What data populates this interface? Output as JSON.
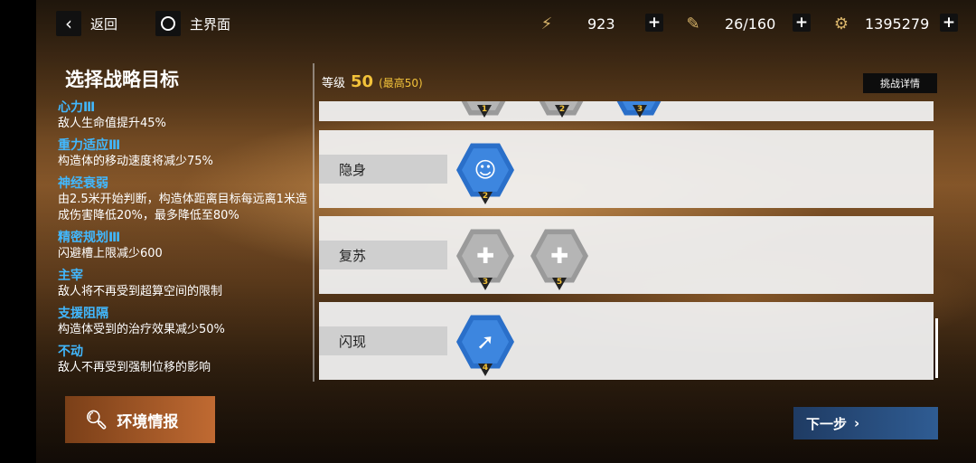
{
  "topbar": {
    "back_label": "返回",
    "home_label": "主界面",
    "resources": [
      {
        "icon": "battery-icon",
        "value": "923"
      },
      {
        "icon": "syringe-icon",
        "value": "26/160"
      },
      {
        "icon": "coin-icon",
        "value": "1395279"
      }
    ],
    "plus_symbol": "+"
  },
  "left_panel": {
    "title": "选择战略目标",
    "goals": [
      {
        "name": "心力Ⅲ",
        "desc": "敌人生命值提升45%"
      },
      {
        "name": "重力适应Ⅲ",
        "desc": "构造体的移动速度将减少75%"
      },
      {
        "name": "神经衰弱",
        "desc": "由2.5米开始判断，构造体距离目标每远离1米造成伤害降低20%，最多降低至80%"
      },
      {
        "name": "精密规划Ⅲ",
        "desc": "闪避槽上限减少600"
      },
      {
        "name": "主宰",
        "desc": "敌人将不再受到超算空间的限制"
      },
      {
        "name": "支援阻隔",
        "desc": "构造体受到的治疗效果减少50%"
      },
      {
        "name": "不动",
        "desc": "敌人不再受到强制位移的影响"
      }
    ]
  },
  "level": {
    "label": "等级",
    "value": "50",
    "max": "(最高50)"
  },
  "detail_button": "挑战详情",
  "rows": [
    {
      "label": "",
      "nodes": [
        {
          "num": "1",
          "color": "grey"
        },
        {
          "num": "2",
          "color": "grey"
        },
        {
          "num": "3",
          "color": "blue"
        }
      ]
    },
    {
      "label": "隐身",
      "nodes": [
        {
          "num": "2",
          "color": "blue",
          "icon": "person-icon"
        }
      ]
    },
    {
      "label": "复苏",
      "nodes": [
        {
          "num": "3",
          "color": "grey",
          "icon": "heal-icon"
        },
        {
          "num": "5",
          "color": "grey",
          "icon": "heal-icon"
        }
      ]
    },
    {
      "label": "闪现",
      "nodes": [
        {
          "num": "4",
          "color": "blue",
          "icon": "dash-icon"
        }
      ]
    }
  ],
  "env_button": "环境情报",
  "next_button": "下一步",
  "colors": {
    "accent_blue": "#3d86df",
    "gold": "#f2c23a",
    "goal_name": "#41b8ff"
  }
}
